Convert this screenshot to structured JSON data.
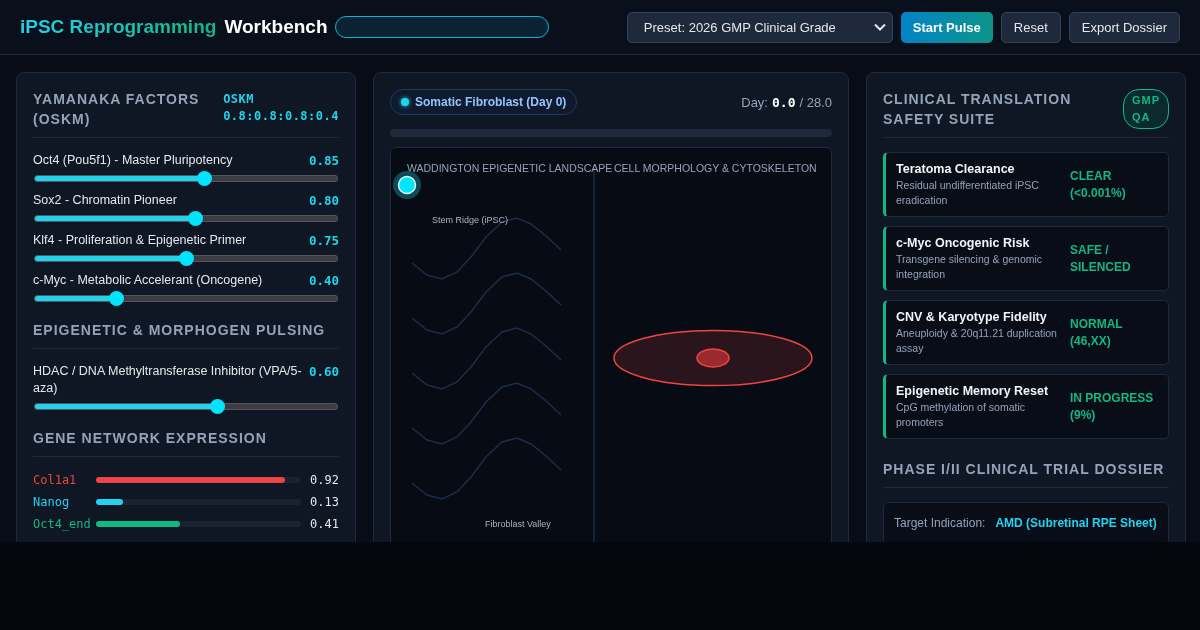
{
  "header": {
    "title_accent": "iPSC Reprogramming",
    "title": "Workbench",
    "preset": "Preset: 2026 GMP Clinical Grade",
    "buttons": [
      {
        "label": "Start Pulse",
        "kind": "primary"
      },
      {
        "label": "Reset",
        "kind": "plain"
      },
      {
        "label": "Export Dossier",
        "kind": "plain"
      }
    ]
  },
  "factors": {
    "title": "YAMANAKA FACTORS (OSKM)",
    "ratio_label": "OSKM",
    "ratio": "0.8:0.8:0.8:0.4",
    "sliders": [
      {
        "label": "Oct4 (Pou5f1) - Master Pluripotency",
        "value": "0.85",
        "level": 0.56
      },
      {
        "label": "Sox2 - Chromatin Pioneer",
        "value": "0.80",
        "level": 0.53
      },
      {
        "label": "Klf4 - Proliferation & Epigenetic Primer",
        "value": "0.75",
        "level": 0.5
      },
      {
        "label": "c-Myc - Metabolic Accelerant (Oncogene)",
        "value": "0.40",
        "level": 0.27
      }
    ]
  },
  "pulsing": {
    "title": "EPIGENETIC & MORPHOGEN PULSING",
    "sliders": [
      {
        "label": "HDAC / DNA Methyltransferase Inhibitor (VPA/5-aza)",
        "value": "0.60",
        "level": 0.6
      }
    ]
  },
  "genes": {
    "title": "GENE NETWORK EXPRESSION",
    "rows": [
      {
        "name": "Col1a1",
        "value": "0.92",
        "level": 0.92,
        "color": "#ef4444"
      },
      {
        "name": "Nanog",
        "value": "0.13",
        "level": 0.13,
        "color": "#22d3ee"
      },
      {
        "name": "Oct4_end",
        "value": "0.41",
        "level": 0.41,
        "color": "#10b981"
      }
    ]
  },
  "center": {
    "stage": "Somatic Fibroblast (Day 0)",
    "day_label": "Day:",
    "day": "0.0",
    "day_total": "/ 28.0",
    "landscape_title": "WADDINGTON EPIGENETIC LANDSCAPE",
    "morphology_title": "CELL MORPHOLOGY & CYTOSKELETON",
    "ridge_label": "Stem Ridge (iPSC)",
    "valley_label": "Fibroblast Valley"
  },
  "safety": {
    "title": "CLINICAL TRANSLATION SAFETY SUITE",
    "badge": "GMP QA",
    "items": [
      {
        "name": "Teratoma Clearance",
        "description": "Residual undifferentiated iPSC eradication",
        "status": "CLEAR (<0.001%)"
      },
      {
        "name": "c-Myc Oncogenic Risk",
        "description": "Transgene silencing & genomic integration",
        "status": "SAFE / SILENCED"
      },
      {
        "name": "CNV & Karyotype Fidelity",
        "description": "Aneuploidy & 20q11.21 duplication assay",
        "status": "NORMAL (46,XX)"
      },
      {
        "name": "Epigenetic Memory Reset",
        "description": "CpG methylation of somatic promoters",
        "status": "IN PROGRESS (9%)"
      }
    ]
  },
  "dossier": {
    "title": "PHASE I/II CLINICAL TRIAL DOSSIER",
    "rows": [
      {
        "label": "Target Indication:",
        "value": "AMD (Subretinal RPE Sheet)"
      }
    ]
  }
}
